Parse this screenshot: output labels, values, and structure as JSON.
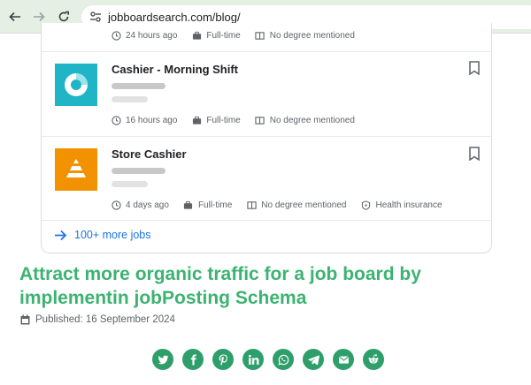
{
  "browser": {
    "url": "jobboardsearch.com/blog/"
  },
  "job_card": {
    "top_row": {
      "posted": "24 hours ago",
      "type": "Full-time",
      "degree": "No degree mentioned"
    },
    "jobs": [
      {
        "title": "Cashier - Morning Shift",
        "posted": "16 hours ago",
        "type": "Full-time",
        "degree": "No degree mentioned",
        "logo_color": "#1fb4c6"
      },
      {
        "title": "Store Cashier",
        "posted": "4 days ago",
        "type": "Full-time",
        "degree": "No degree mentioned",
        "benefit": "Health insurance",
        "logo_color": "#f39200"
      }
    ],
    "more_link": "100+ more jobs"
  },
  "article": {
    "headline": "Attract more organic traffic for a job board by implementin jobPosting Schema",
    "published": "Published: 16 September 2024"
  },
  "share_icons": [
    "twitter-icon",
    "facebook-icon",
    "pinterest-icon",
    "linkedin-icon",
    "whatsapp-icon",
    "telegram-icon",
    "email-icon",
    "reddit-icon"
  ],
  "colors": {
    "accent_green": "#3cb371",
    "share_green": "#2e9e6a",
    "link_blue": "#1a73e8"
  }
}
